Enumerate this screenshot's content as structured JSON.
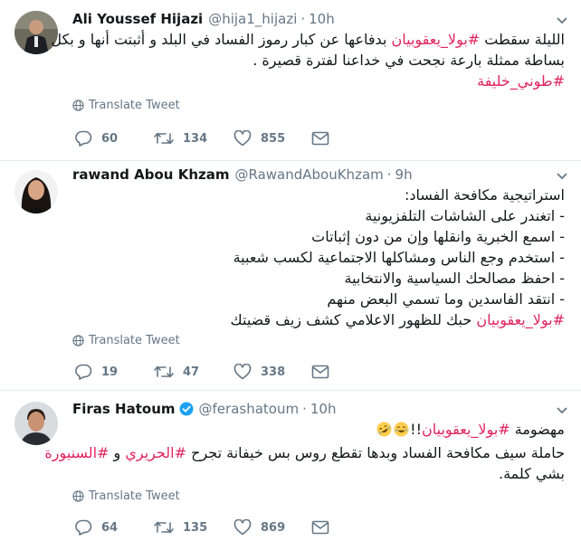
{
  "tweets": [
    {
      "name": "Ali Youssef Hijazi",
      "handle": "@hija1_hijazi",
      "time": "10h",
      "verified": false,
      "lines": [
        [
          {
            "t": "الليلة سقطت "
          },
          {
            "t": "#بولا_يعقوبيان",
            "h": true
          },
          {
            "t": " بدفاعها عن كبار رموز الفساد في البلد و أثبتت أنها و بكل"
          }
        ],
        [
          {
            "t": "بساطة ممثلة بارعة نجحت في خداعنا لفترة قصيرة ."
          }
        ],
        [
          {
            "t": "#طوني_خليفة",
            "h": true
          }
        ]
      ],
      "translate": "Translate Tweet",
      "replies": "60",
      "retweets": "134",
      "likes": "855"
    },
    {
      "name": "rawand Abou Khzam",
      "handle": "@RawandAbouKhzam",
      "time": "9h",
      "verified": false,
      "lines": [
        [
          {
            "t": "استراتيجية مكافحة الفساد:"
          }
        ],
        [
          {
            "t": "- اتغندر على الشاشات التلفزيونية"
          }
        ],
        [
          {
            "t": "- اسمع الخبرية وانقلها وإن من دون إثباتات"
          }
        ],
        [
          {
            "t": "- استخدم وجع الناس ومشاكلها الاجتماعية لكسب شعبية"
          }
        ],
        [
          {
            "t": "- احفظ مصالحك السياسية والانتخابية"
          }
        ],
        [
          {
            "t": "- انتقد الفاسدين وما تسمي البعض منهم"
          }
        ],
        [
          {
            "t": "#بولا_يعقوبيان",
            "h": true
          },
          {
            "t": " حبك للظهور الاعلامي كشف زيف قضيتك"
          }
        ]
      ],
      "translate": "Translate Tweet",
      "replies": "19",
      "retweets": "47",
      "likes": "338"
    },
    {
      "name": "Firas Hatoum",
      "handle": "@ferashatoum",
      "time": "10h",
      "verified": true,
      "lines": [
        [
          {
            "t": "مهضومة "
          },
          {
            "t": "#بولا_يعقوبيان",
            "h": true
          },
          {
            "t": "!!"
          },
          {
            "emoji": "joy"
          },
          {
            "emoji": "rofl"
          }
        ],
        [
          {
            "t": "حاملة سيف مكافحة الفساد وبدها تقطع روس بس خيفانة  تجرح "
          },
          {
            "t": "#الحريري",
            "h": true
          },
          {
            "t": " و "
          },
          {
            "t": "#السنيورة",
            "h": true
          }
        ],
        [
          {
            "t": "بشي كلمة."
          }
        ]
      ],
      "translate": "Translate Tweet",
      "replies": "64",
      "retweets": "135",
      "likes": "869"
    }
  ],
  "colors": {
    "hashtag": "#e0245e",
    "meta": "#657786",
    "text": "#14171a",
    "verified": "#1da1f2",
    "divider": "#e6ecf0"
  },
  "icons": {
    "reply": "reply-icon",
    "retweet": "retweet-icon",
    "like": "heart-icon",
    "dm": "envelope-icon",
    "translate": "globe-icon",
    "menu": "chevron-down-icon",
    "verified": "verified-badge-icon"
  }
}
